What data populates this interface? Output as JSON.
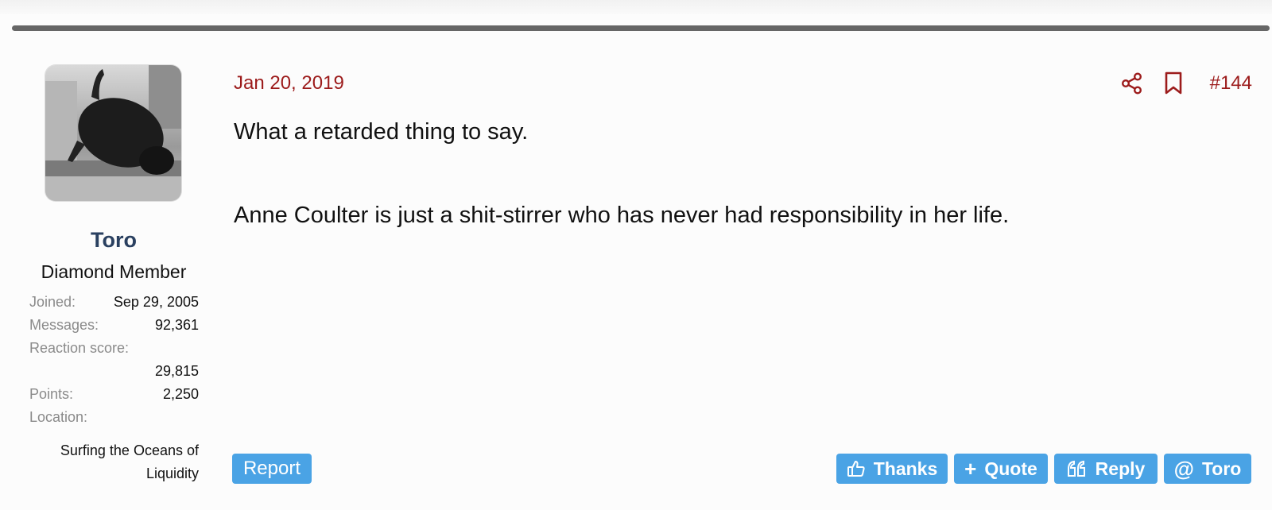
{
  "post": {
    "date": "Jan 20, 2019",
    "number": "#144",
    "paragraphs": [
      "What a retarded thing to say.",
      "Anne Coulter is just a shit-stirrer who has never had responsibility in her life."
    ]
  },
  "user": {
    "name": "Toro",
    "title": "Diamond Member",
    "stats": {
      "joined_label": "Joined:",
      "joined_value": "Sep 29, 2005",
      "messages_label": "Messages:",
      "messages_value": "92,361",
      "reaction_label": "Reaction score:",
      "reaction_value": "29,815",
      "points_label": "Points:",
      "points_value": "2,250",
      "location_label": "Location:",
      "location_value": "Surfing the Oceans of Liquidity"
    }
  },
  "actions": {
    "report": "Report",
    "thanks": "Thanks",
    "quote": "Quote",
    "reply": "Reply",
    "mention": "Toro",
    "quote_glyph": "+",
    "mention_glyph": "@"
  },
  "icons": {
    "share": "share-icon",
    "bookmark": "bookmark-icon",
    "thumbs_up": "thumbs-up-icon",
    "reply_quote": "quote-marks-icon"
  },
  "colors": {
    "accent_red": "#9c1b1b",
    "button_blue": "#4aa3e5",
    "username_navy": "#2a4060"
  }
}
